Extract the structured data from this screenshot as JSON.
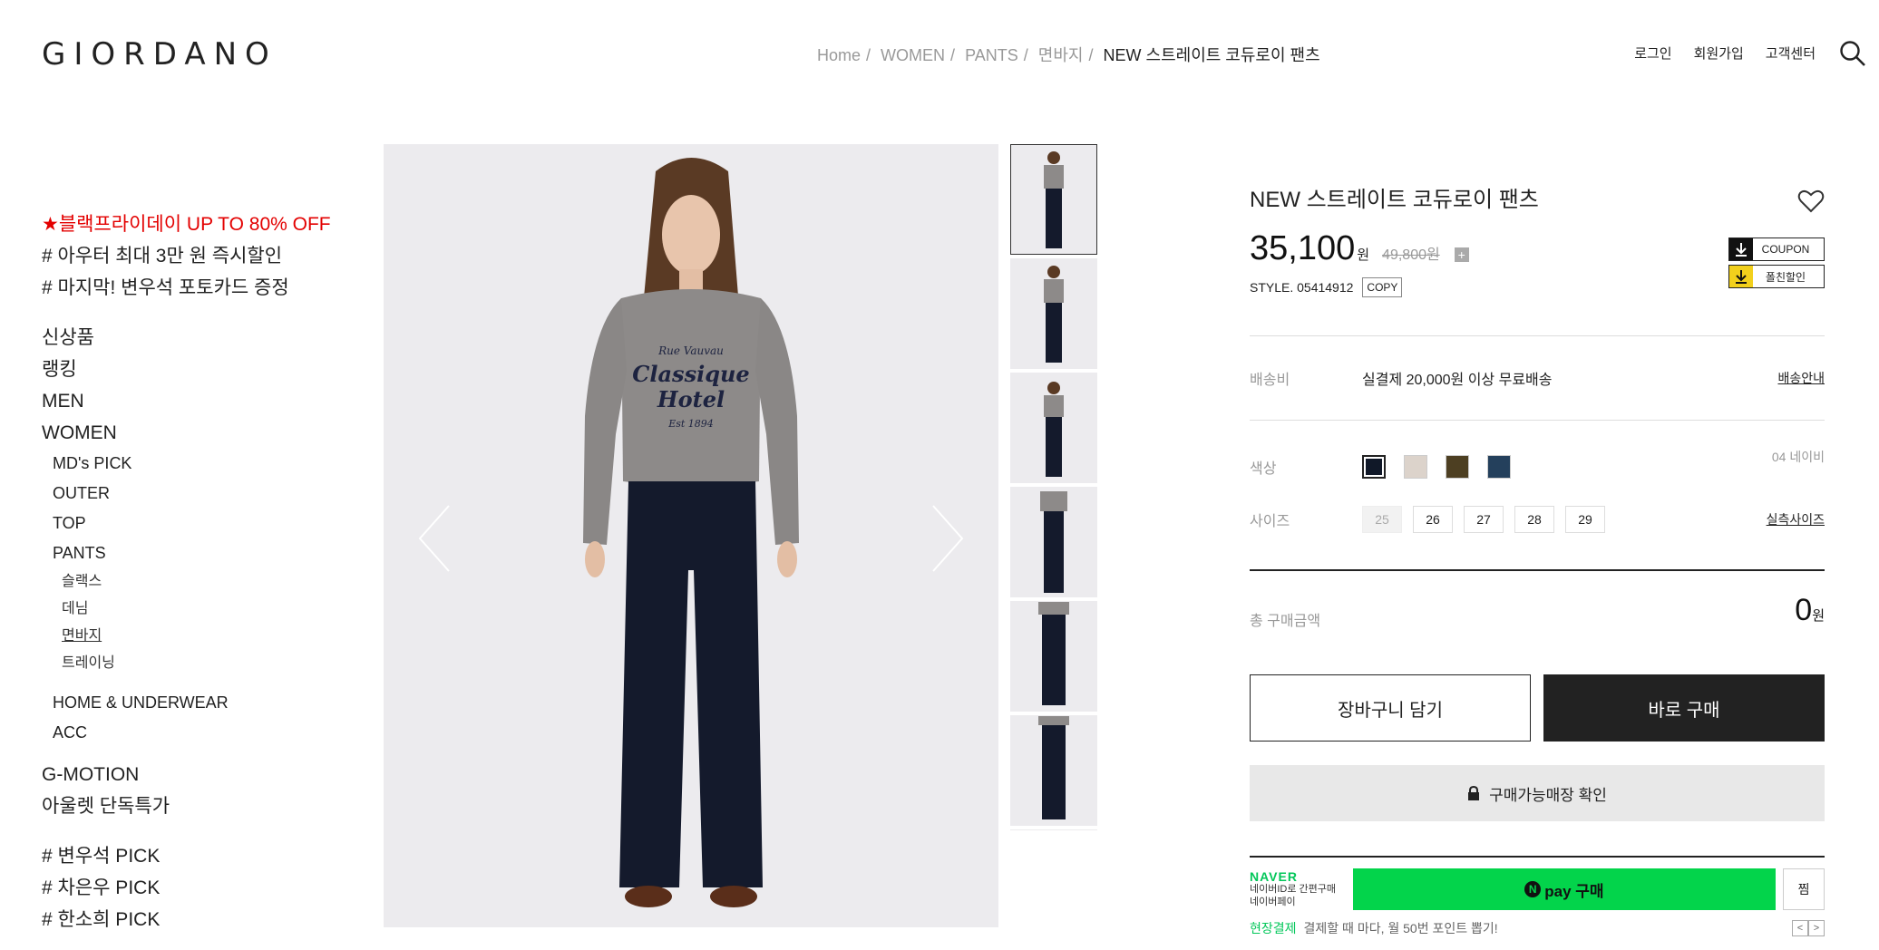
{
  "header": {
    "logo": "GIORDANO",
    "breadcrumb": [
      "Home",
      "WOMEN",
      "PANTS",
      "면바지"
    ],
    "breadcrumb_current": "NEW 스트레이트 코듀로이 팬츠",
    "links": [
      "로그인",
      "회원가입",
      "고객센터"
    ],
    "search_icon": "search-icon"
  },
  "sidebar": {
    "promos": [
      "★블랙프라이데이 UP TO 80% OFF",
      "# 아우터 최대 3만 원 즉시할인",
      "# 마지막! 변우석 포토카드 증정"
    ],
    "categories": {
      "new": "신상품",
      "ranking": "랭킹",
      "men": "MEN",
      "women": "WOMEN",
      "mds_pick": "MD's PICK",
      "outer": "OUTER",
      "top": "TOP",
      "pants": "PANTS",
      "slacks": "슬랙스",
      "denim": "데님",
      "cotton": "면바지",
      "training": "트레이닝",
      "home_underwear": "HOME & UNDERWEAR",
      "acc": "ACC",
      "gmotion": "G-MOTION",
      "outlet": "아울렛 단독특가"
    },
    "picks": [
      "# 변우석 PICK",
      "# 차은우 PICK",
      "# 한소희 PICK"
    ]
  },
  "product": {
    "title": "NEW 스트레이트 코듀로이 팬츠",
    "price": "35,100",
    "won": "원",
    "original_price": "49,800원",
    "style_label": "STYLE. 05414912",
    "copy_label": "COPY",
    "coupon_label": "COUPON",
    "friend_label": "폴친할인",
    "shipping_label": "배송비",
    "shipping_value": "실결제 20,000원 이상 무료배송",
    "shipping_link": "배송안내",
    "color_label": "색상",
    "color_selected_name": "04 네이비",
    "colors": [
      "#101828",
      "#dcd3cb",
      "#4d3f22",
      "#24405c"
    ],
    "size_label": "사이즈",
    "sizes": [
      "25",
      "26",
      "27",
      "28",
      "29"
    ],
    "size_guide": "실측사이즈",
    "total_label": "총 구매금액",
    "total_value": "0",
    "cart_button": "장바구니 담기",
    "buy_button": "바로 구매",
    "store_button": "구매가능매장 확인"
  },
  "naver": {
    "brand": "NAVER",
    "line1": "네이버ID로 간편구매",
    "line2": "네이버페이",
    "pay_label": "pay 구매",
    "jjim_label": "찜",
    "promo_green": "현장결제",
    "promo_text": "결제할 때 마다, 월 50번 포인트 뽑기!"
  },
  "colors": {
    "accent_red": "#e30000",
    "naver_green": "#03d44b",
    "dark": "#222222"
  }
}
